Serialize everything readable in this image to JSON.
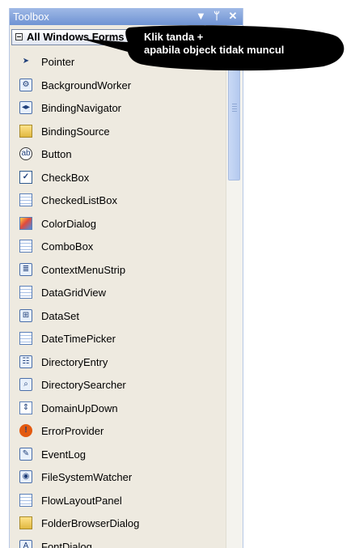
{
  "toolbox": {
    "title": "Toolbox",
    "controls": {
      "dropdown_icon": "chevron-down-icon",
      "pin_icon": "pin-icon",
      "close_icon": "close-icon",
      "dropdown_glyph": "▼",
      "pin_glyph": "ᛘ",
      "close_glyph": "✕"
    },
    "group_label": "All Windows Forms",
    "items": [
      {
        "label": "Pointer",
        "icon": "pointer-icon"
      },
      {
        "label": "BackgroundWorker",
        "icon": "background-worker-icon"
      },
      {
        "label": "BindingNavigator",
        "icon": "binding-navigator-icon"
      },
      {
        "label": "BindingSource",
        "icon": "binding-source-icon"
      },
      {
        "label": "Button",
        "icon": "button-icon"
      },
      {
        "label": "CheckBox",
        "icon": "checkbox-icon"
      },
      {
        "label": "CheckedListBox",
        "icon": "checked-list-box-icon"
      },
      {
        "label": "ColorDialog",
        "icon": "color-dialog-icon"
      },
      {
        "label": "ComboBox",
        "icon": "combobox-icon"
      },
      {
        "label": "ContextMenuStrip",
        "icon": "context-menu-strip-icon"
      },
      {
        "label": "DataGridView",
        "icon": "data-grid-view-icon"
      },
      {
        "label": "DataSet",
        "icon": "dataset-icon"
      },
      {
        "label": "DateTimePicker",
        "icon": "date-time-picker-icon"
      },
      {
        "label": "DirectoryEntry",
        "icon": "directory-entry-icon"
      },
      {
        "label": "DirectorySearcher",
        "icon": "directory-searcher-icon"
      },
      {
        "label": "DomainUpDown",
        "icon": "domain-up-down-icon"
      },
      {
        "label": "ErrorProvider",
        "icon": "error-provider-icon"
      },
      {
        "label": "EventLog",
        "icon": "event-log-icon"
      },
      {
        "label": "FileSystemWatcher",
        "icon": "file-system-watcher-icon"
      },
      {
        "label": "FlowLayoutPanel",
        "icon": "flow-layout-panel-icon"
      },
      {
        "label": "FolderBrowserDialog",
        "icon": "folder-browser-dialog-icon"
      },
      {
        "label": "FontDialog",
        "icon": "font-dialog-icon"
      }
    ]
  },
  "callout": {
    "line1": "Klik tanda +",
    "line2": "apabila objeck tidak muncul"
  },
  "colors": {
    "titlebar": "#7fa0dc",
    "panel_background": "#eeeae0",
    "callout_background": "#000000"
  }
}
